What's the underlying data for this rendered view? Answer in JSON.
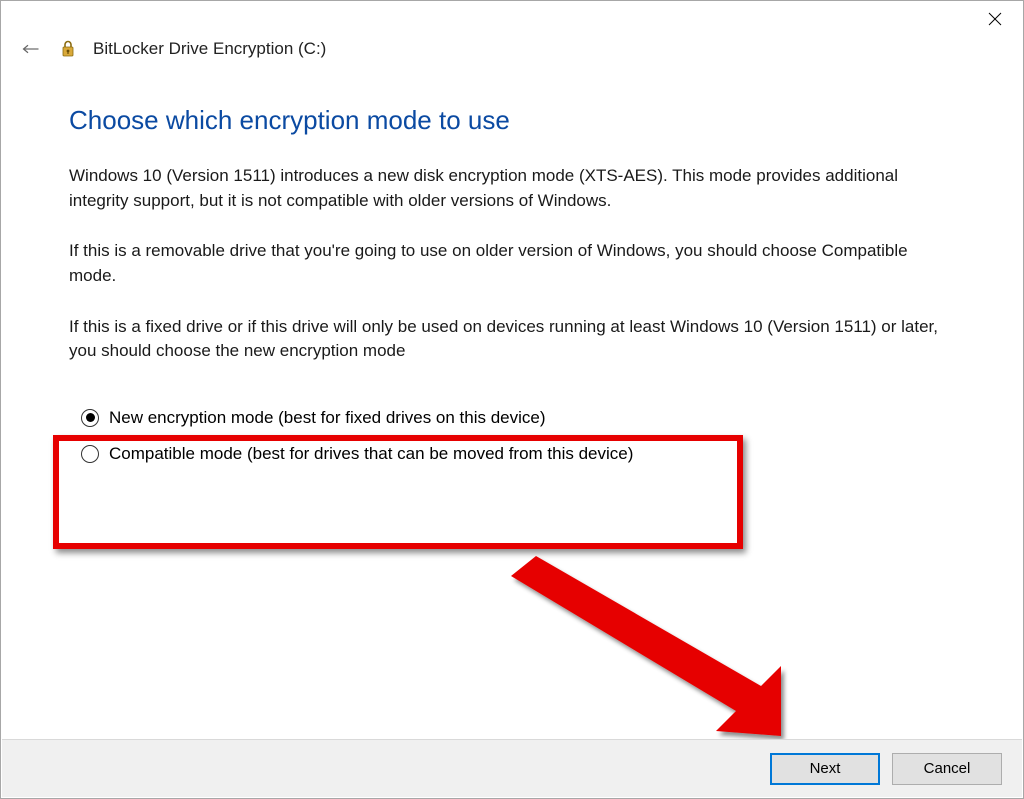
{
  "window": {
    "app_title": "BitLocker Drive Encryption (C:)"
  },
  "heading": "Choose which encryption mode to use",
  "paragraphs": {
    "p1": "Windows 10 (Version 1511) introduces a new disk encryption mode (XTS-AES). This mode provides additional integrity support, but it is not compatible with older versions of Windows.",
    "p2": "If this is a removable drive that you're going to use on older version of Windows, you should choose Compatible mode.",
    "p3": "If this is a fixed drive or if this drive will only be used on devices running at least Windows 10 (Version 1511) or later, you should choose the new encryption mode"
  },
  "options": {
    "new_mode": "New encryption mode (best for fixed drives on this device)",
    "compatible_mode": "Compatible mode (best for drives that can be moved from this device)",
    "selected": "new_mode"
  },
  "buttons": {
    "next": "Next",
    "cancel": "Cancel"
  },
  "annotation": {
    "highlight_color": "#e60000"
  }
}
